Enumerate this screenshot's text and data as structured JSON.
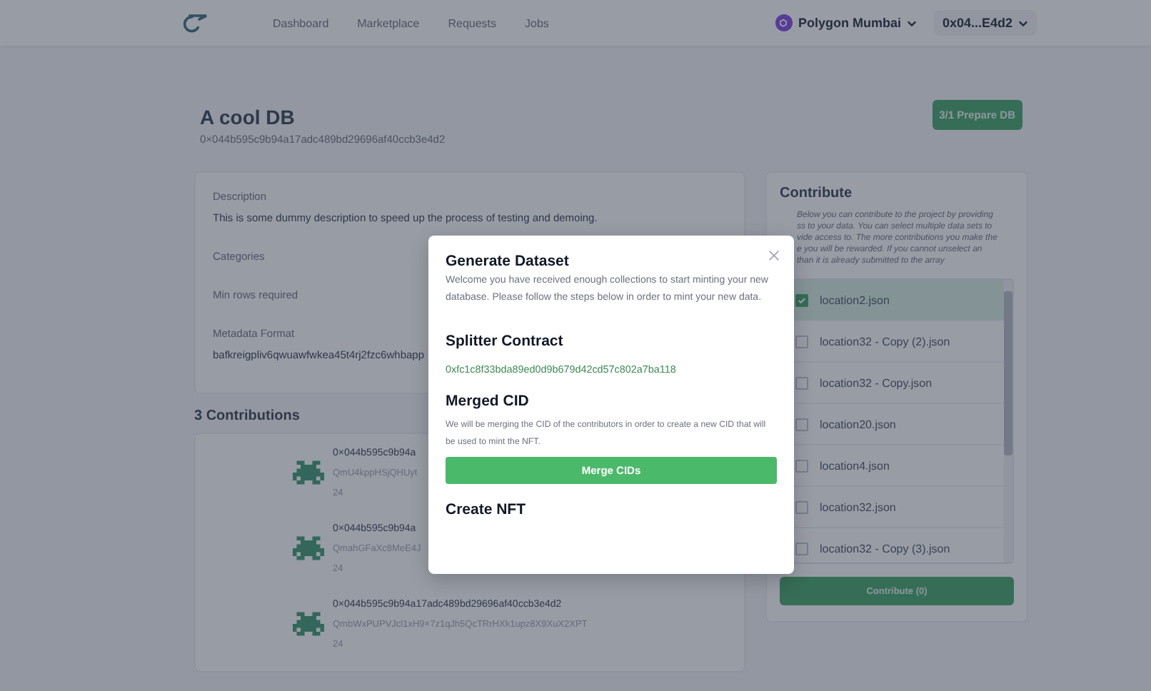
{
  "nav": {
    "links": [
      {
        "label": "Dashboard"
      },
      {
        "label": "Marketplace"
      },
      {
        "label": "Requests"
      },
      {
        "label": "Jobs"
      }
    ],
    "network": "Polygon Mumbai",
    "account": "0x04...E4d2"
  },
  "header": {
    "title": "A cool DB",
    "address": "0×044b595c9b94a17adc489bd29696af40ccb3e4d2",
    "action": "3/1 Prepare DB"
  },
  "details": [
    {
      "label": "Description",
      "value": "This is some dummy description to speed up the process of testing and demoing."
    },
    {
      "label": "Categories"
    },
    {
      "label": "Min rows required"
    },
    {
      "label": "Metadata Format",
      "value": "bafkreigpliv6qwuawfwkea45t4rj2fzc6whbapp"
    }
  ],
  "contributions": {
    "title": "3 Contributions",
    "items": [
      {
        "address": "0×044b595c9b94a",
        "cid": "QmU4kppHSjQHUyt",
        "rows": "24"
      },
      {
        "address": "0×044b595c9b94a",
        "cid": "QmahGFaXc8MeE4J",
        "rows": "24"
      },
      {
        "address": "0×044b595c9b94a17adc489bd29696af40ccb3e4d2",
        "cid": "QmbWxPUPVJcl1xH9×7z1qJh5QcTRrHXk1upz8X9XuX2XPT",
        "rows": "24"
      }
    ]
  },
  "contribute": {
    "title": "Contribute",
    "description": [
      "Below you can contribute to the project by providing",
      "ss to your data. You can select multiple data sets to",
      "vide access to. The more contributions you make the",
      "e you will be rewarded. If you cannot unselect an",
      "than it is already submitted to the array"
    ],
    "files": [
      {
        "name": "location2.json",
        "checked": true
      },
      {
        "name": "location32 - Copy (2).json",
        "checked": false
      },
      {
        "name": "location32 - Copy.json",
        "checked": false
      },
      {
        "name": "location20.json",
        "checked": false
      },
      {
        "name": "location4.json",
        "checked": false
      },
      {
        "name": "location32.json",
        "checked": false
      },
      {
        "name": "location32 - Copy (3).json",
        "checked": false
      }
    ],
    "button": "Contribute (0)"
  },
  "modal": {
    "title": "Generate Dataset",
    "intro": "Welcome you have received enough collections to start minting your new database. Please follow the steps below in order to mint your new data.",
    "steps": [
      {
        "kind": "address",
        "title": "Splitter Contract",
        "value": "0xfc1c8f33bda89ed0d9b679d42cd57c802a7ba118"
      },
      {
        "kind": "action",
        "title": "Merged CID",
        "text": "We will be merging the CID of the contributors in order to create a new CID that will be used to mint the NFT.",
        "button": "Merge CIDs"
      },
      {
        "kind": "heading",
        "title": "Create NFT"
      }
    ]
  }
}
